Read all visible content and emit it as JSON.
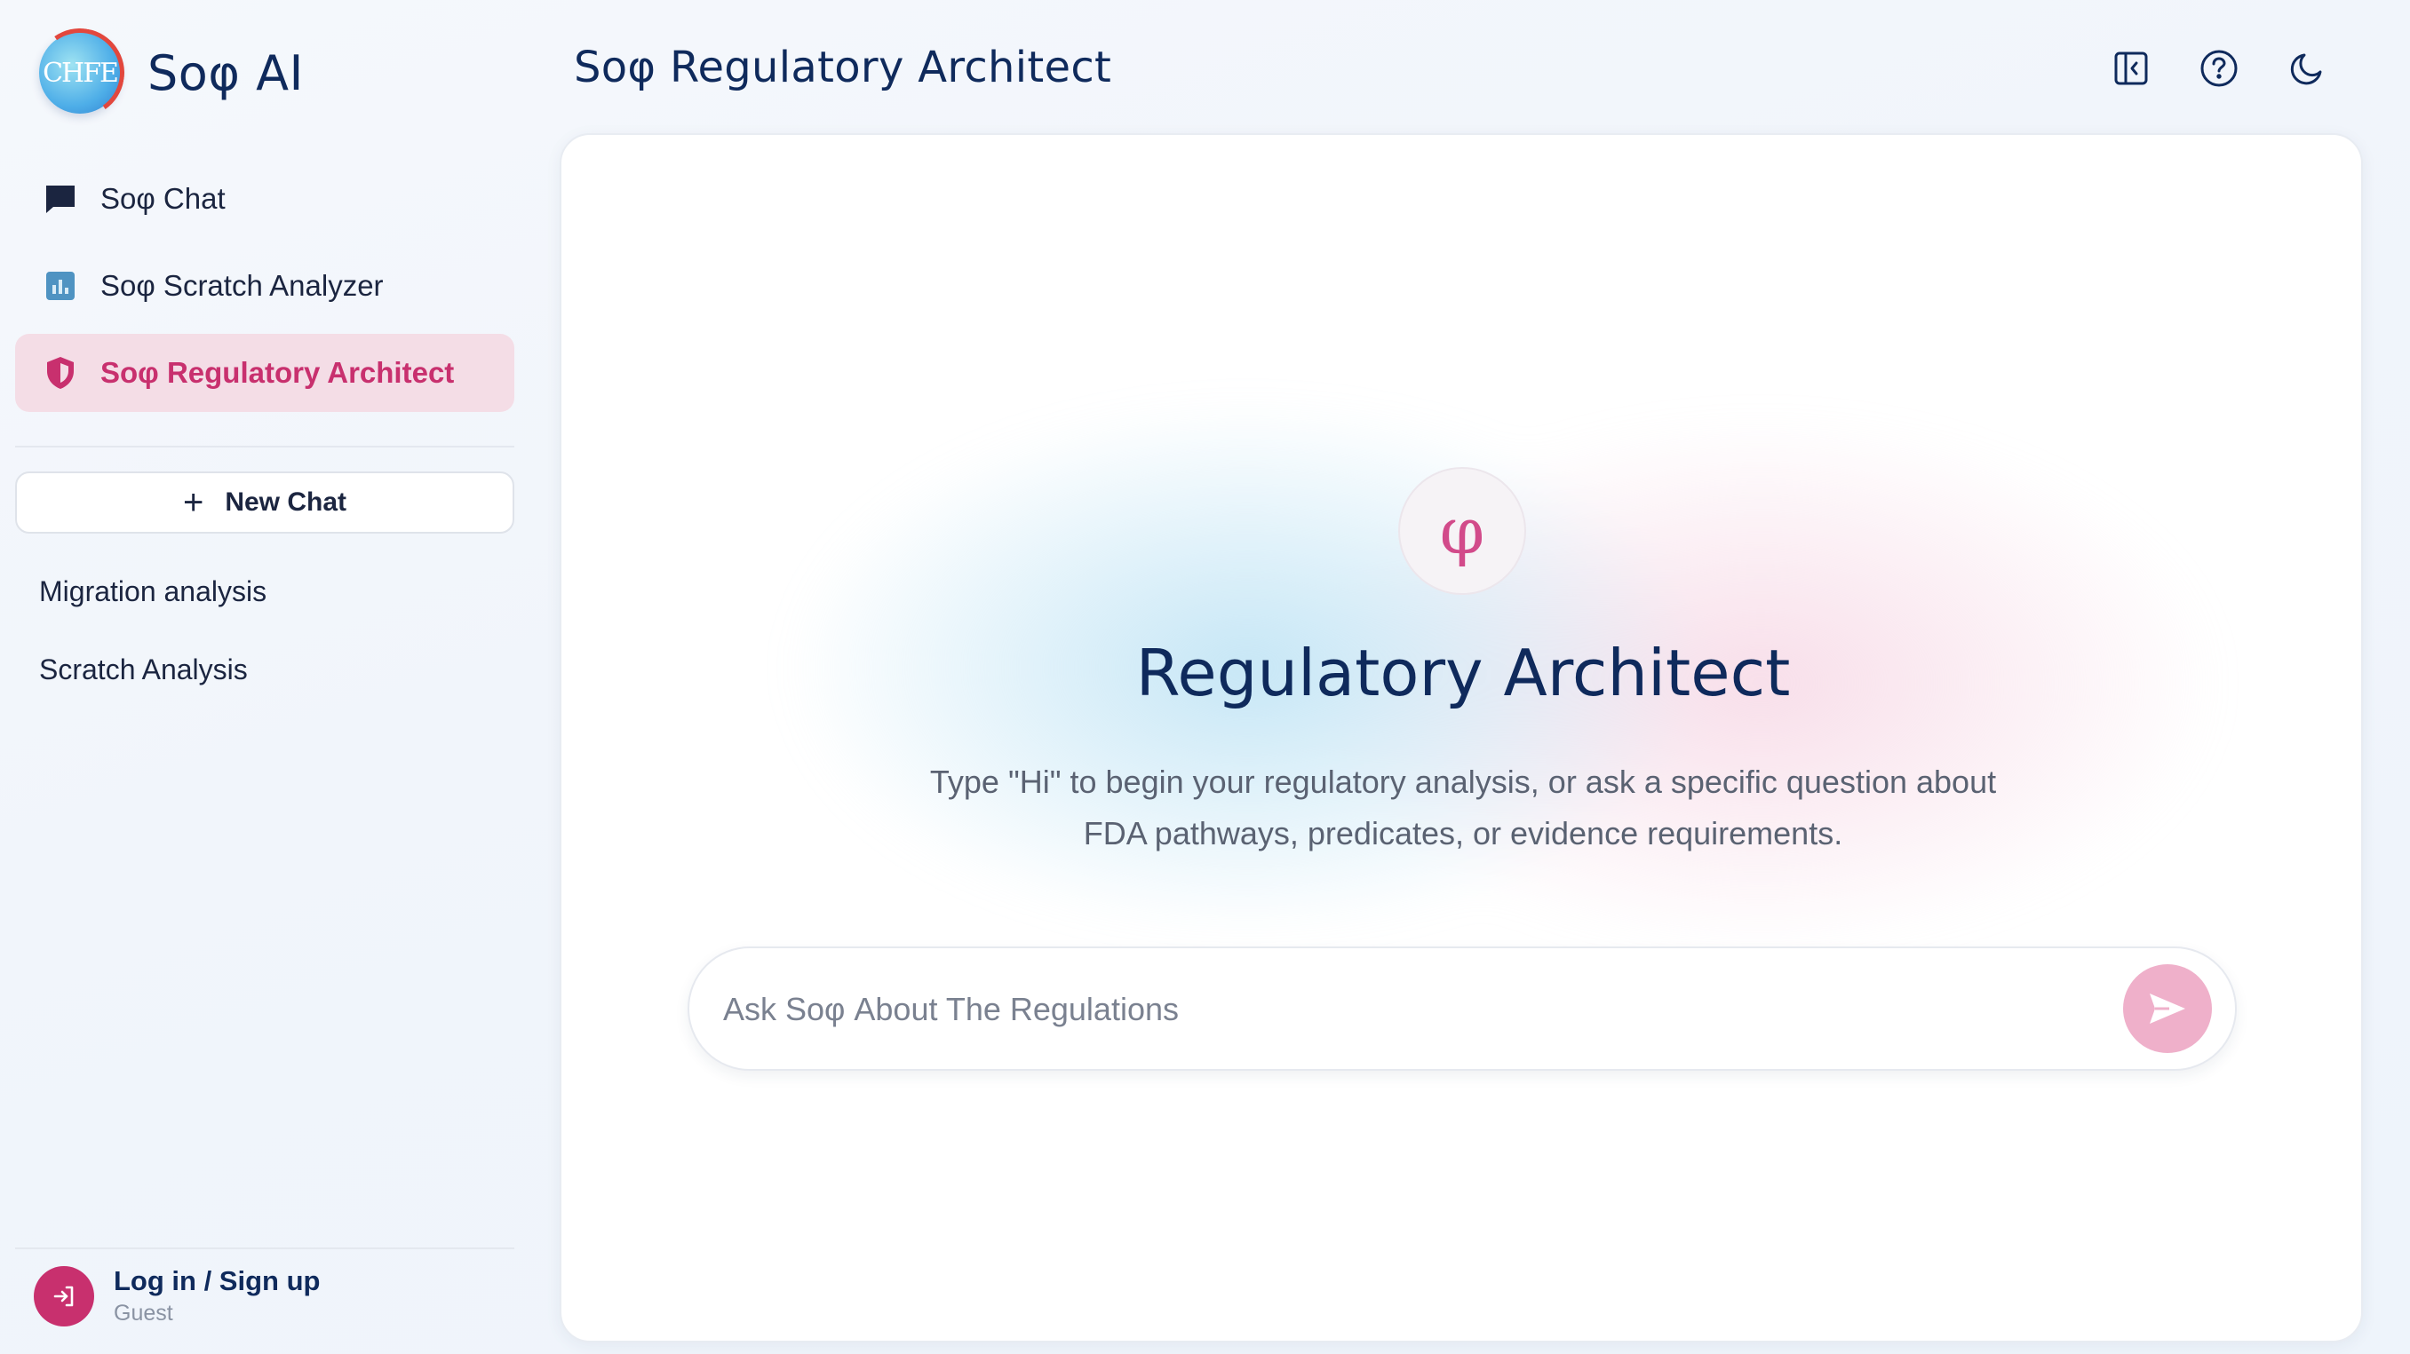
{
  "app": {
    "name": "Soφ AI",
    "logo_text": "CHFE"
  },
  "header": {
    "title": "Soφ Regulatory Architect"
  },
  "top_actions": [
    {
      "name": "toggle-sidebar",
      "icon": "sidebar-toggle-icon"
    },
    {
      "name": "help",
      "icon": "help-circle-icon"
    },
    {
      "name": "theme",
      "icon": "moon-icon"
    }
  ],
  "sidebar": {
    "nav": [
      {
        "label": "Soφ Chat",
        "icon": "chat-bubble-icon",
        "active": false
      },
      {
        "label": "Soφ Scratch Analyzer",
        "icon": "bar-chart-icon",
        "active": false
      },
      {
        "label": "Soφ Regulatory Architect",
        "icon": "shield-icon",
        "active": true
      }
    ],
    "new_chat_label": "New Chat",
    "history": [
      "Migration analysis",
      "Scratch Analysis"
    ],
    "user": {
      "login_label": "Log in / Sign up",
      "role": "Guest"
    }
  },
  "hero": {
    "symbol": "φ",
    "title": "Regulatory Architect",
    "subtitle_line1": "Type \"Hi\" to begin your regulatory analysis, or ask a specific question about",
    "subtitle_line2": "FDA pathways, predicates, or evidence requirements."
  },
  "chat_input": {
    "placeholder": "Ask Soφ About The Regulations",
    "value": ""
  },
  "colors": {
    "accent": "#c8306e",
    "active_bg": "#f4dde6",
    "send_button": "#efb0ca",
    "title": "#0f2a5c"
  }
}
